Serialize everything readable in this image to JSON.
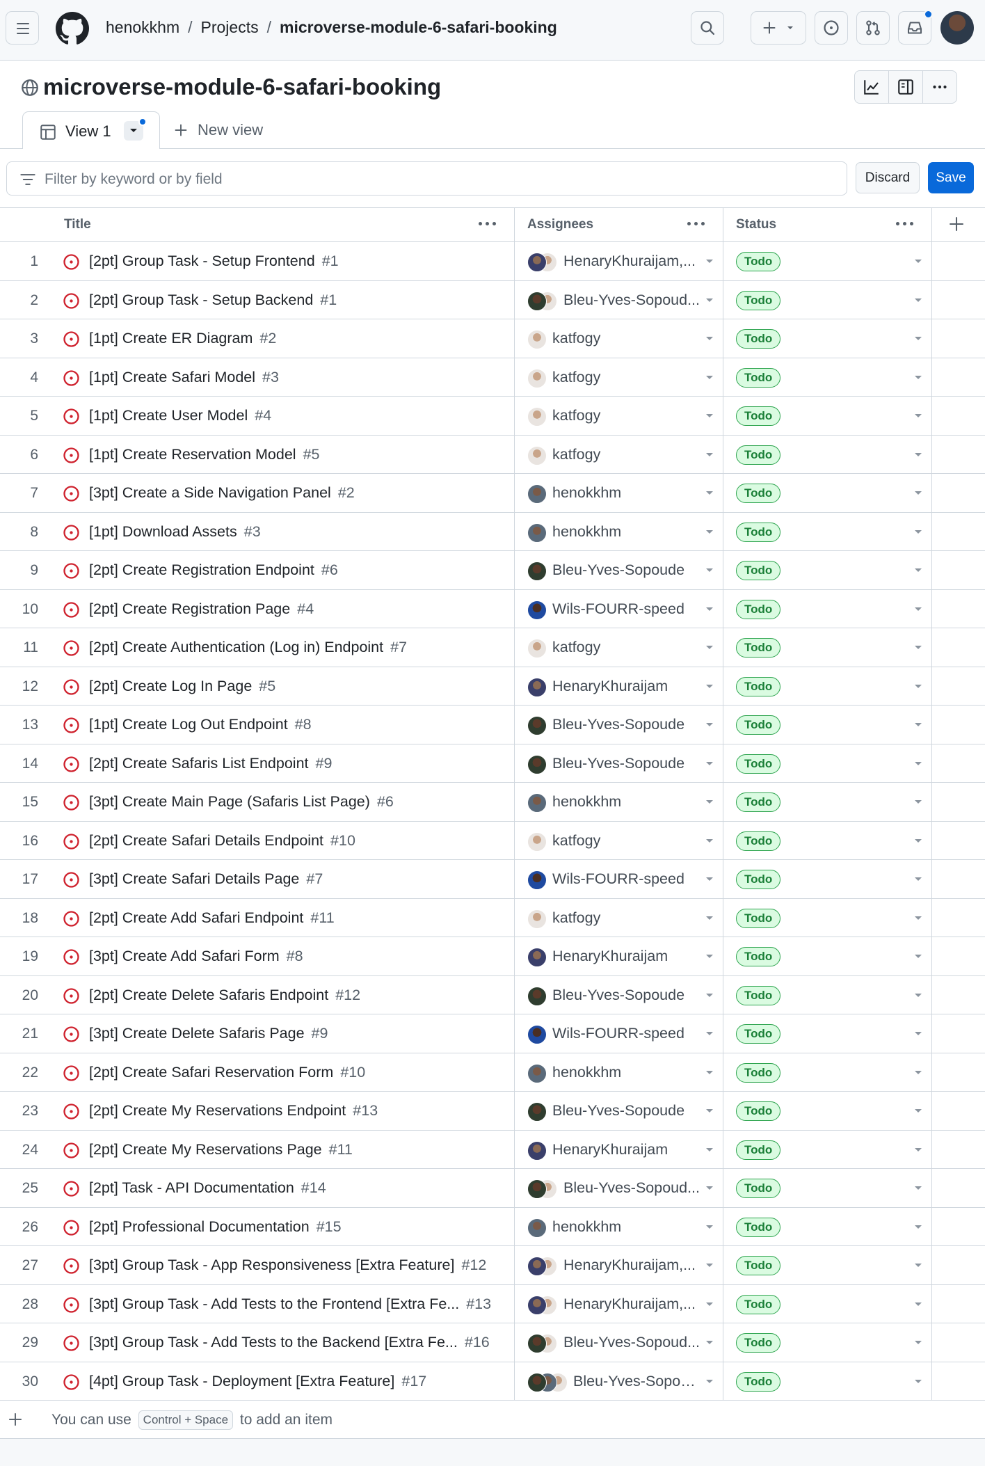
{
  "header": {
    "breadcrumb": [
      "henokkhm",
      "Projects",
      "microverse-module-6-safari-booking"
    ]
  },
  "project": {
    "title": "microverse-module-6-safari-booking",
    "tab_label": "View 1",
    "new_view_label": "New view"
  },
  "filter": {
    "placeholder": "Filter by keyword or by field",
    "discard_label": "Discard",
    "save_label": "Save"
  },
  "columns": {
    "title": "Title",
    "assignees": "Assignees",
    "status": "Status"
  },
  "colors": {
    "accent": "#0969da",
    "open_issue": "#cf222e",
    "todo_bg": "#dafbe1",
    "todo_text": "#1a7f37"
  },
  "rows": [
    {
      "n": "1",
      "title": "[2pt] Group Task - Setup Frontend",
      "num": "#1",
      "assignee": "HenaryKhuraijam,...",
      "avatars": [
        "henary",
        "katfogy"
      ],
      "status": "Todo"
    },
    {
      "n": "2",
      "title": "[2pt] Group Task - Setup Backend",
      "num": "#1",
      "assignee": "Bleu-Yves-Sopoud...",
      "avatars": [
        "bleu",
        "katfogy"
      ],
      "status": "Todo"
    },
    {
      "n": "3",
      "title": "[1pt] Create ER Diagram",
      "num": "#2",
      "assignee": "katfogy",
      "avatars": [
        "katfogy"
      ],
      "status": "Todo"
    },
    {
      "n": "4",
      "title": "[1pt] Create Safari Model",
      "num": "#3",
      "assignee": "katfogy",
      "avatars": [
        "katfogy"
      ],
      "status": "Todo"
    },
    {
      "n": "5",
      "title": "[1pt] Create User Model",
      "num": "#4",
      "assignee": "katfogy",
      "avatars": [
        "katfogy"
      ],
      "status": "Todo"
    },
    {
      "n": "6",
      "title": "[1pt] Create Reservation Model",
      "num": "#5",
      "assignee": "katfogy",
      "avatars": [
        "katfogy"
      ],
      "status": "Todo"
    },
    {
      "n": "7",
      "title": "[3pt] Create a Side Navigation Panel",
      "num": "#2",
      "assignee": "henokkhm",
      "avatars": [
        "henok"
      ],
      "status": "Todo"
    },
    {
      "n": "8",
      "title": "[1pt] Download Assets",
      "num": "#3",
      "assignee": "henokkhm",
      "avatars": [
        "henok"
      ],
      "status": "Todo"
    },
    {
      "n": "9",
      "title": "[2pt] Create Registration Endpoint",
      "num": "#6",
      "assignee": "Bleu-Yves-Sopoude",
      "avatars": [
        "bleu"
      ],
      "status": "Todo"
    },
    {
      "n": "10",
      "title": "[2pt] Create Registration Page",
      "num": "#4",
      "assignee": "Wils-FOURR-speed",
      "avatars": [
        "wils"
      ],
      "status": "Todo"
    },
    {
      "n": "11",
      "title": "[2pt] Create Authentication (Log in) Endpoint",
      "num": "#7",
      "assignee": "katfogy",
      "avatars": [
        "katfogy"
      ],
      "status": "Todo"
    },
    {
      "n": "12",
      "title": "[2pt] Create Log In Page",
      "num": "#5",
      "assignee": "HenaryKhuraijam",
      "avatars": [
        "henary"
      ],
      "status": "Todo"
    },
    {
      "n": "13",
      "title": "[1pt] Create Log Out Endpoint",
      "num": "#8",
      "assignee": "Bleu-Yves-Sopoude",
      "avatars": [
        "bleu"
      ],
      "status": "Todo"
    },
    {
      "n": "14",
      "title": "[2pt] Create Safaris List Endpoint",
      "num": "#9",
      "assignee": "Bleu-Yves-Sopoude",
      "avatars": [
        "bleu"
      ],
      "status": "Todo"
    },
    {
      "n": "15",
      "title": "[3pt] Create Main Page (Safaris List Page)",
      "num": "#6",
      "assignee": "henokkhm",
      "avatars": [
        "henok"
      ],
      "status": "Todo"
    },
    {
      "n": "16",
      "title": "[2pt] Create Safari Details Endpoint",
      "num": "#10",
      "assignee": "katfogy",
      "avatars": [
        "katfogy"
      ],
      "status": "Todo"
    },
    {
      "n": "17",
      "title": "[3pt] Create Safari Details Page",
      "num": "#7",
      "assignee": "Wils-FOURR-speed",
      "avatars": [
        "wils"
      ],
      "status": "Todo"
    },
    {
      "n": "18",
      "title": "[2pt] Create Add Safari Endpoint",
      "num": "#11",
      "assignee": "katfogy",
      "avatars": [
        "katfogy"
      ],
      "status": "Todo"
    },
    {
      "n": "19",
      "title": "[3pt] Create Add Safari Form",
      "num": "#8",
      "assignee": "HenaryKhuraijam",
      "avatars": [
        "henary"
      ],
      "status": "Todo"
    },
    {
      "n": "20",
      "title": "[2pt] Create Delete Safaris Endpoint",
      "num": "#12",
      "assignee": "Bleu-Yves-Sopoude",
      "avatars": [
        "bleu"
      ],
      "status": "Todo"
    },
    {
      "n": "21",
      "title": "[3pt] Create Delete Safaris Page",
      "num": "#9",
      "assignee": "Wils-FOURR-speed",
      "avatars": [
        "wils"
      ],
      "status": "Todo"
    },
    {
      "n": "22",
      "title": "[2pt] Create Safari Reservation Form",
      "num": "#10",
      "assignee": "henokkhm",
      "avatars": [
        "henok"
      ],
      "status": "Todo"
    },
    {
      "n": "23",
      "title": "[2pt] Create My Reservations Endpoint",
      "num": "#13",
      "assignee": "Bleu-Yves-Sopoude",
      "avatars": [
        "bleu"
      ],
      "status": "Todo"
    },
    {
      "n": "24",
      "title": "[2pt] Create My Reservations Page",
      "num": "#11",
      "assignee": "HenaryKhuraijam",
      "avatars": [
        "henary"
      ],
      "status": "Todo"
    },
    {
      "n": "25",
      "title": "[2pt] Task - API Documentation",
      "num": "#14",
      "assignee": "Bleu-Yves-Sopoud...",
      "avatars": [
        "bleu",
        "katfogy"
      ],
      "status": "Todo"
    },
    {
      "n": "26",
      "title": "[2pt] Professional Documentation",
      "num": "#15",
      "assignee": "henokkhm",
      "avatars": [
        "henok"
      ],
      "status": "Todo"
    },
    {
      "n": "27",
      "title": "[3pt] Group Task - App Responsiveness [Extra Feature]",
      "num": "#12",
      "assignee": "HenaryKhuraijam,...",
      "avatars": [
        "henary",
        "katfogy"
      ],
      "status": "Todo"
    },
    {
      "n": "28",
      "title": "[3pt] Group Task - Add Tests to the Frontend [Extra Fe...",
      "num": "#13",
      "assignee": "HenaryKhuraijam,...",
      "avatars": [
        "henary",
        "katfogy"
      ],
      "status": "Todo"
    },
    {
      "n": "29",
      "title": "[3pt] Group Task - Add Tests to the Backend [Extra Fe...",
      "num": "#16",
      "assignee": "Bleu-Yves-Sopoud...",
      "avatars": [
        "bleu",
        "katfogy"
      ],
      "status": "Todo"
    },
    {
      "n": "30",
      "title": "[4pt] Group Task - Deployment [Extra Feature]",
      "num": "#17",
      "assignee": "Bleu-Yves-Sopou...",
      "avatars": [
        "bleu",
        "henok",
        "katfogy"
      ],
      "status": "Todo"
    }
  ],
  "add_item": {
    "prefix": "You can use",
    "shortcut": "Control + Space",
    "suffix": "to add an item"
  }
}
